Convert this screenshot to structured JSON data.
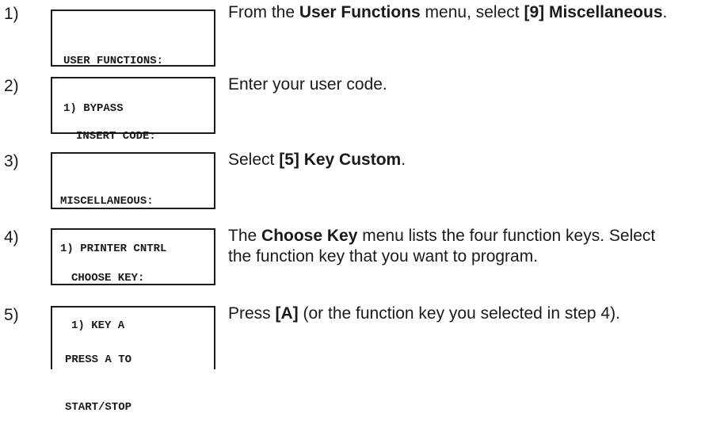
{
  "steps": [
    {
      "number": "1)",
      "lcd": [
        "USER FUNCTIONS:",
        "1) BYPASS"
      ],
      "text": [
        "From the ",
        {
          "b": "User Functions"
        },
        " menu, select ",
        {
          "b": "[9] Miscellaneous"
        },
        "."
      ]
    },
    {
      "number": "2)",
      "lcd": [
        "INSERT CODE:"
      ],
      "text": [
        "Enter your user code."
      ]
    },
    {
      "number": "3)",
      "lcd": [
        "MISCELLANEOUS:",
        "1) PRINTER CNTRL"
      ],
      "text": [
        "Select ",
        {
          "b": "[5] Key Custom"
        },
        "."
      ]
    },
    {
      "number": "4)",
      "lcd": [
        "CHOOSE KEY:",
        "1) KEY A"
      ],
      "text": [
        "The ",
        {
          "b": "Choose Key"
        },
        " menu lists the four function keys. Select the function key that you want to program."
      ]
    },
    {
      "number": "5)",
      "lcd": [
        "PRESS A TO",
        "START/STOP"
      ],
      "text": [
        "Press ",
        {
          "b": "[A]"
        },
        " (or the function key you selected in step 4)."
      ]
    }
  ]
}
